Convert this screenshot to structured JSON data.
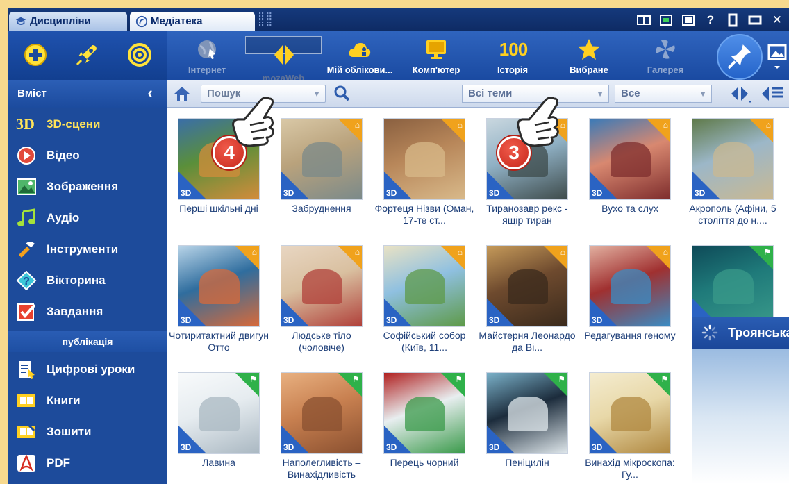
{
  "tabs": [
    {
      "label": "Дисципліни",
      "icon": "graduation-cap-icon"
    },
    {
      "label": "Медіатека",
      "icon": "media-library-icon"
    }
  ],
  "window_controls": [
    "list-view-icon",
    "green-square-icon",
    "window-icon",
    "help-icon",
    "restore-icon",
    "maximize-icon",
    "close-icon"
  ],
  "toolbar": {
    "left_icons": [
      "add-icon",
      "rocket-icon",
      "target-icon"
    ],
    "buttons": [
      {
        "label": "Інтернет",
        "icon": "globe-icon",
        "disabled": true
      },
      {
        "label": "mozaWeb",
        "icon": "mozaweb-icon",
        "selected": true
      },
      {
        "label": "Мій облікови...",
        "icon": "cloud-user-icon"
      },
      {
        "label": "Комп'ютер",
        "icon": "monitor-icon"
      },
      {
        "label": "Історія",
        "icon": "history-100-icon",
        "icon_text": "100"
      },
      {
        "label": "Вибране",
        "icon": "star-icon"
      },
      {
        "label": "Галерея",
        "icon": "gallery-icon",
        "disabled": true
      }
    ]
  },
  "sidebar": {
    "header": "Вміст",
    "items": [
      {
        "label": "3D-сцени",
        "icon": "3d-icon",
        "icon_text": "3D",
        "active": true
      },
      {
        "label": "Відео",
        "icon": "video-play-icon"
      },
      {
        "label": "Зображення",
        "icon": "image-icon"
      },
      {
        "label": "Аудіо",
        "icon": "music-note-icon"
      },
      {
        "label": "Інструменти",
        "icon": "tools-icon"
      },
      {
        "label": "Вікторина",
        "icon": "quiz-icon"
      },
      {
        "label": "Завдання",
        "icon": "task-check-icon"
      }
    ],
    "section": "публікація",
    "items2": [
      {
        "label": "Цифрові уроки",
        "icon": "digital-lesson-icon"
      },
      {
        "label": "Книги",
        "icon": "book-icon"
      },
      {
        "label": "Зошити",
        "icon": "notebook-icon"
      },
      {
        "label": "PDF",
        "icon": "pdf-icon"
      }
    ]
  },
  "filters": {
    "search_placeholder": "Пошук",
    "themes": "Всі теми",
    "scope": "Все"
  },
  "cards": [
    {
      "title": "Перші шкільні дні",
      "corner": "gift",
      "colors": [
        "#5a8f3a",
        "#d38c3b",
        "#3a6ea8"
      ]
    },
    {
      "title": "Забруднення",
      "corner": "gift",
      "colors": [
        "#b9a27c",
        "#7b8a8a",
        "#d9c8a6"
      ]
    },
    {
      "title": "Фортеця Нізви (Оман, 17-те ст...",
      "corner": "gift",
      "colors": [
        "#b8875a",
        "#d8b98a",
        "#8a6040"
      ]
    },
    {
      "title": "Тиранозавр рекс - ящір тиран",
      "corner": "gift",
      "colors": [
        "#8fb0c4",
        "#3e4b4b",
        "#c9d7df"
      ]
    },
    {
      "title": "Вухо та слух",
      "corner": "gift",
      "colors": [
        "#d88870",
        "#7e2d2d",
        "#3a7ab8"
      ]
    },
    {
      "title": "Акрополь (Афіни, 5 століття до н....",
      "corner": "gift",
      "colors": [
        "#9cb7c8",
        "#c9b892",
        "#5f7a4a"
      ]
    },
    {
      "title": "Чотиритактний двигун Отто",
      "corner": "gift",
      "colors": [
        "#2f6d9e",
        "#d86a3a",
        "#b8d4e8"
      ]
    },
    {
      "title": "Людське тіло (чоловіче)",
      "corner": "gift",
      "colors": [
        "#d9c0a0",
        "#b0403a",
        "#e8d6c2"
      ]
    },
    {
      "title": "Софійський собор (Київ, 11...",
      "corner": "gift",
      "colors": [
        "#8fc0e0",
        "#5e9a48",
        "#e9e2c4"
      ]
    },
    {
      "title": "Майстерня Леонардо да Ві...",
      "corner": "gift",
      "colors": [
        "#6e4a2e",
        "#3a2a1c",
        "#c59a5a"
      ]
    },
    {
      "title": "Редагування геному",
      "corner": "gift",
      "colors": [
        "#a03030",
        "#3a8cc4",
        "#e2b0a0"
      ]
    },
    {
      "title": "",
      "corner": "flag",
      "colors": [
        "#1f7a7a",
        "#3a9a8a",
        "#0e4a58"
      ]
    },
    {
      "title": "Лавина",
      "corner": "flag",
      "colors": [
        "#e6ecf0",
        "#aab8c2",
        "#f8fafb"
      ]
    },
    {
      "title": "Наполегливість – Винахідливість",
      "corner": "flag",
      "colors": [
        "#c88050",
        "#8a5030",
        "#e8b080"
      ]
    },
    {
      "title": "Перець чорний",
      "corner": "flag",
      "colors": [
        "#e8eef0",
        "#3a9a4a",
        "#b02020"
      ]
    },
    {
      "title": "Пеніцилін",
      "corner": "flag",
      "colors": [
        "#1c2c3c",
        "#e0e8ec",
        "#7ab0c8"
      ]
    },
    {
      "title": "Винахід мікроскопа: Гу...",
      "corner": "flag",
      "colors": [
        "#e8d8a8",
        "#b08840",
        "#f4ecd0"
      ]
    }
  ],
  "popup": {
    "title": "Троянська",
    "icon": "loading-spinner-icon"
  },
  "badges": [
    "4",
    "3"
  ]
}
